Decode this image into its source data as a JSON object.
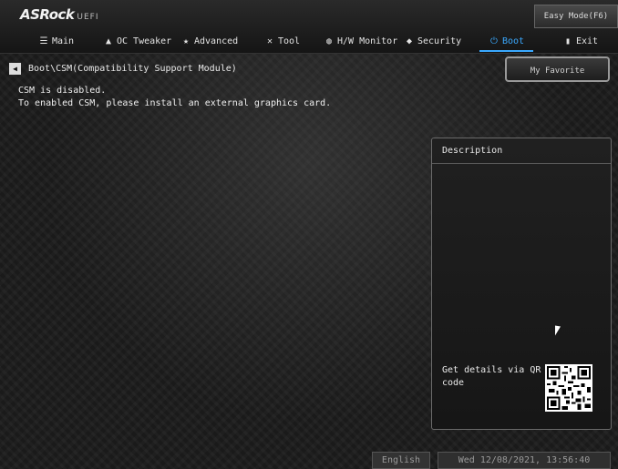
{
  "header": {
    "logo": "ASRock",
    "logo_suffix": "UEFI",
    "easy_mode": "Easy Mode(F6)"
  },
  "menu": [
    {
      "label": "Main",
      "icon": "list-icon"
    },
    {
      "label": "OC Tweaker",
      "icon": "rocket-icon"
    },
    {
      "label": "Advanced",
      "icon": "star-icon"
    },
    {
      "label": "Tool",
      "icon": "tools-icon"
    },
    {
      "label": "H/W Monitor",
      "icon": "monitor-globe-icon"
    },
    {
      "label": "Security",
      "icon": "shield-icon"
    },
    {
      "label": "Boot",
      "icon": "power-icon",
      "active": true
    },
    {
      "label": "Exit",
      "icon": "exit-door-icon"
    }
  ],
  "breadcrumb": "Boot\\CSM(Compatibility Support Module)",
  "favorite_button": "My Favorite",
  "message": {
    "line1": "CSM is disabled.",
    "line2": "To enabled CSM, please install an external graphics card."
  },
  "description": {
    "title": "Description",
    "qr_text": "Get details via QR code"
  },
  "footer": {
    "language": "English",
    "datetime": "Wed 12/08/2021, 13:56:40"
  },
  "colors": {
    "accent": "#3aa9ff",
    "background": "#1c1c1c"
  }
}
